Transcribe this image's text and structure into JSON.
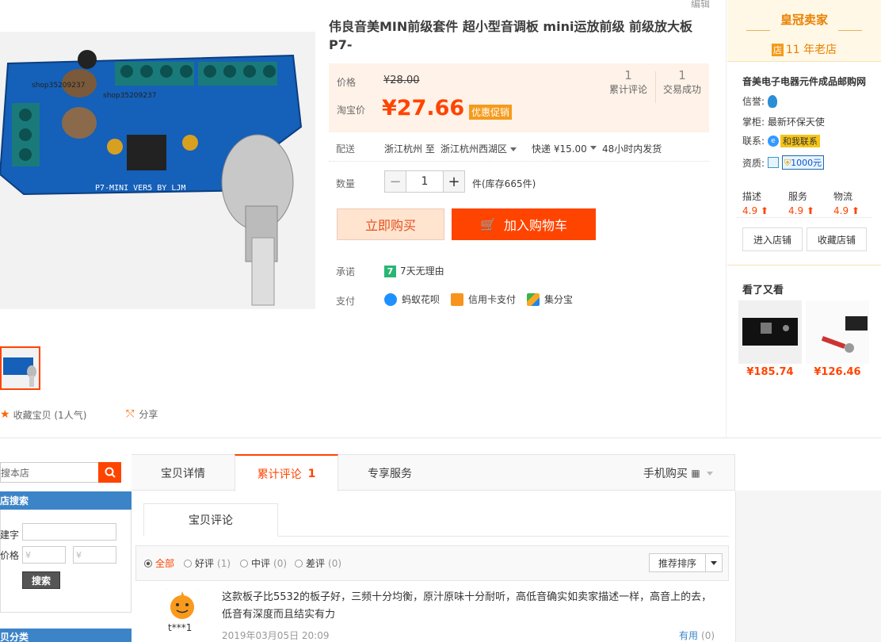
{
  "product": {
    "edit_link": "编辑",
    "title": "伟良音美MIN前级套件 超小型音调板 mini运放前级 前级放大板P7-",
    "watermark_1": "shop35209237",
    "watermark_2": "shop35209237",
    "board_label": "P7-MINI   VER5   BY LJM",
    "favorite": "收藏宝贝 (1人气)",
    "share": "分享"
  },
  "price": {
    "label": "价格",
    "original": "¥28.00",
    "tb_label": "淘宝价",
    "currency": "¥",
    "current": "27.66",
    "promo": "优惠促销",
    "reviews_count": "1",
    "reviews_label": "累计评论",
    "sales_count": "1",
    "sales_label": "交易成功"
  },
  "delivery": {
    "label": "配送",
    "from": "浙江杭州 至",
    "to": "浙江杭州西湖区",
    "express": "快递 ¥15.00",
    "ship_time": "48小时内发货"
  },
  "quantity": {
    "label": "数量",
    "minus": "−",
    "value": "1",
    "plus": "+",
    "stock": "件(库存665件)"
  },
  "actions": {
    "buy_now": "立即购买",
    "add_cart": "加入购物车"
  },
  "promise": {
    "label": "承诺",
    "icon_text": "7",
    "text": "7天无理由"
  },
  "payment": {
    "label": "支付",
    "methods": [
      "蚂蚁花呗",
      "信用卡支付",
      "集分宝"
    ]
  },
  "shop": {
    "crown": "皇冠卖家",
    "old_badge": "店",
    "old_text": "11 年老店",
    "name": "音美电子电器元件成品邮购网",
    "credit_label": "信誉:",
    "keeper_label": "掌柜:",
    "keeper": "最新环保天使",
    "contact_label": "联系:",
    "contact_dot": "e",
    "contact": "和我联系",
    "qual_label": "资质:",
    "deposit": "1000元",
    "ratings": [
      {
        "label": "描述",
        "value": "4.9"
      },
      {
        "label": "服务",
        "value": "4.9"
      },
      {
        "label": "物流",
        "value": "4.9"
      }
    ],
    "enter": "进入店铺",
    "collect": "收藏店铺",
    "see_also": "看了又看",
    "related": [
      {
        "price": "¥185.74"
      },
      {
        "price": "¥126.46"
      }
    ]
  },
  "sidebar": {
    "search_placeholder": "搜本店",
    "shop_search": "店搜索",
    "keyword_label": "建字",
    "price_label": "价格",
    "price_min": "¥",
    "price_max": "¥",
    "search_button": "搜索",
    "category": "贝分类"
  },
  "tabs": {
    "detail": "宝贝详情",
    "reviews": "累计评论",
    "reviews_count": "1",
    "service": "专享服务",
    "mobile": "手机购买"
  },
  "reviews": {
    "sub_tab": "宝贝评论",
    "filters": [
      {
        "label": "全部",
        "count": ""
      },
      {
        "label": "好评",
        "count": "(1)"
      },
      {
        "label": "中评",
        "count": "(0)"
      },
      {
        "label": "差评",
        "count": "(0)"
      }
    ],
    "sort": "推荐排序",
    "items": [
      {
        "user": "t***1",
        "text": "这款板子比5532的板子好，三频十分均衡，原汁原味十分耐听，高低音确实如卖家描述一样，高音上的去，低音有深度而且结实有力",
        "date": "2019年03月05日 20:09",
        "useful": "有用",
        "useful_count": "(0)"
      }
    ]
  },
  "colors": {
    "accent": "#ff4400",
    "blue_header": "#3c84c8",
    "crown": "#e88000"
  }
}
